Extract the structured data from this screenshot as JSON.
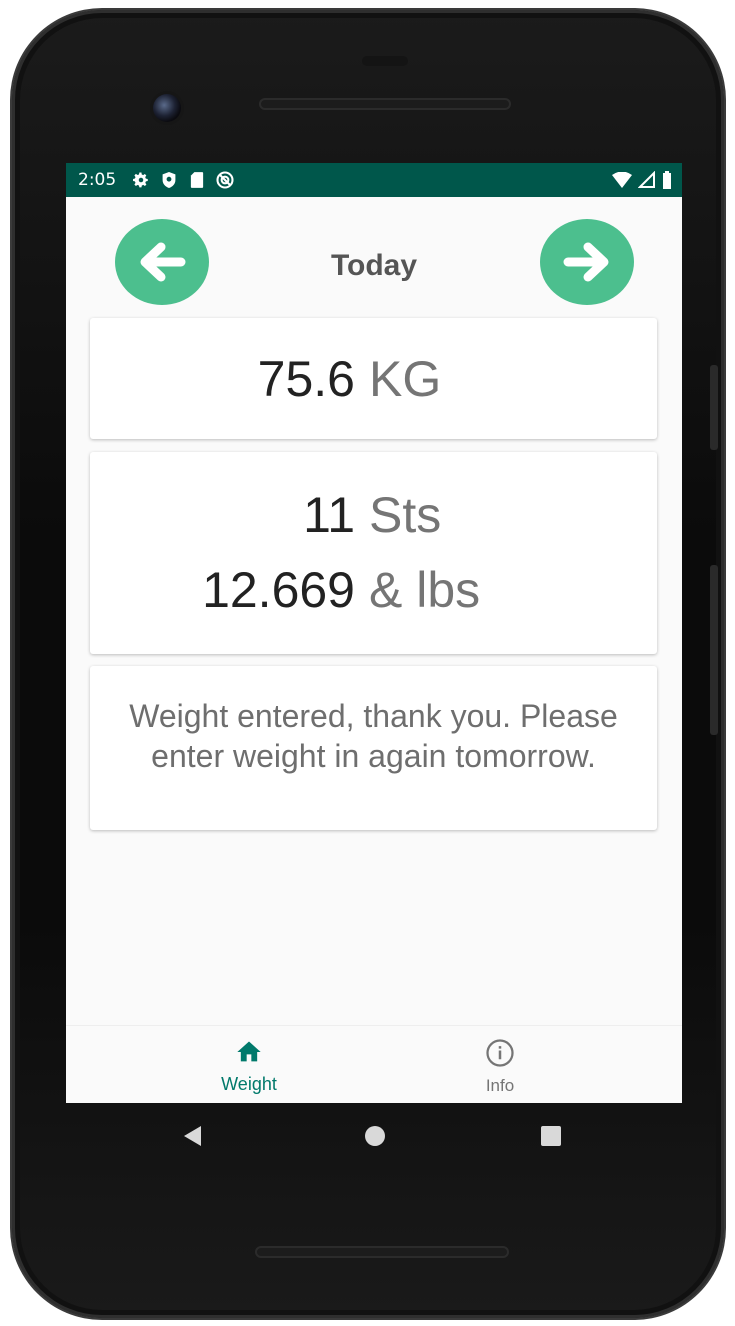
{
  "status_bar": {
    "time": "2:05",
    "background": "#00574b",
    "left_icons": [
      "settings-icon",
      "shield-icon",
      "sd-card-icon",
      "do-not-disturb-icon"
    ],
    "right_icons": [
      "wifi-icon",
      "signal-icon",
      "battery-icon"
    ]
  },
  "header": {
    "title": "Today",
    "prev_icon": "arrow-left-icon",
    "next_icon": "arrow-right-icon",
    "button_color": "#4cbf8e"
  },
  "kg_card": {
    "value": "75.6",
    "unit": "KG"
  },
  "stone_card": {
    "stones_value": "11",
    "stones_unit": "Sts",
    "pounds_value": "12.669",
    "pounds_unit": "& lbs"
  },
  "message_card": {
    "text": "Weight entered, thank you. Please enter weight in again tomorrow."
  },
  "bottom_nav": {
    "tabs": [
      {
        "label": "Weight",
        "icon": "home-icon",
        "active": true,
        "color": "#00796b"
      },
      {
        "label": "Info",
        "icon": "info-icon",
        "active": false,
        "color": "#757575"
      }
    ]
  },
  "system_nav": {
    "buttons": [
      "back-icon",
      "home-circle-icon",
      "recents-icon"
    ]
  }
}
